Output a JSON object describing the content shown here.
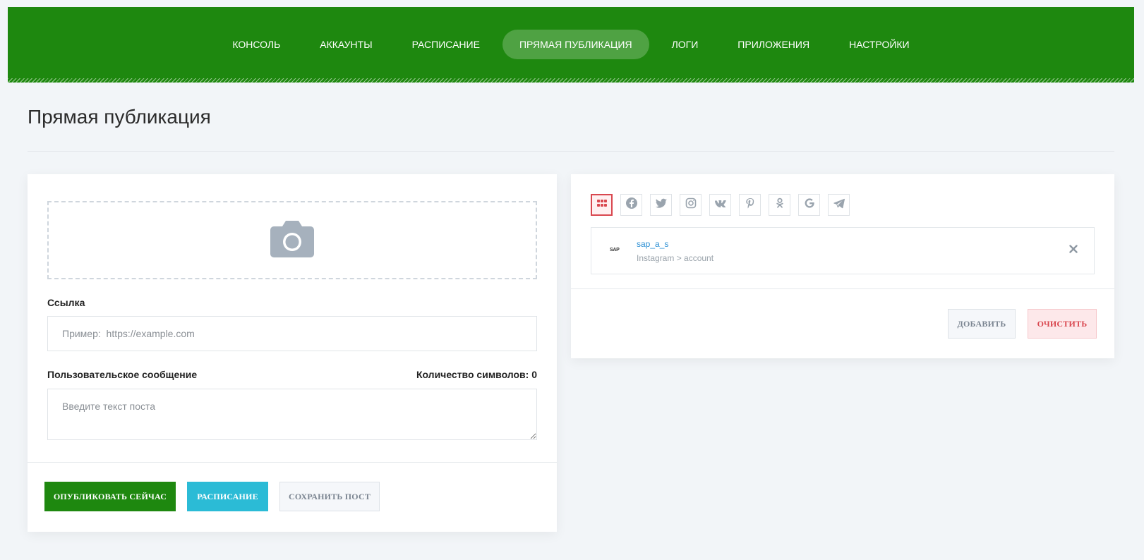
{
  "nav": {
    "items": [
      {
        "label": "КОНСОЛЬ"
      },
      {
        "label": "АККАУНТЫ"
      },
      {
        "label": "РАСПИСАНИЕ"
      },
      {
        "label": "ПРЯМАЯ ПУБЛИКАЦИЯ",
        "active": true
      },
      {
        "label": "ЛОГИ"
      },
      {
        "label": "ПРИЛОЖЕНИЯ"
      },
      {
        "label": "НАСТРОЙКИ"
      }
    ]
  },
  "page": {
    "title": "Прямая публикация"
  },
  "form": {
    "uploader_icon": "camera-icon",
    "link_label": "Ссылка",
    "link_placeholder": "Пример:  https://example.com",
    "link_value": "",
    "message_label": "Пользовательское сообщение",
    "char_count_label": "Количество символов: 0",
    "message_placeholder": "Введите текст поста",
    "message_value": ""
  },
  "actions": {
    "publish_now": "ОПУБЛИКОВАТЬ СЕЙЧАС",
    "schedule": "РАСПИСАНИЕ",
    "save_post": "СОХРАНИТЬ ПОСТ"
  },
  "accounts_panel": {
    "filters": [
      {
        "icon": "apps-grid-icon",
        "active": true
      },
      {
        "icon": "facebook-icon"
      },
      {
        "icon": "twitter-icon"
      },
      {
        "icon": "instagram-icon"
      },
      {
        "icon": "vk-icon"
      },
      {
        "icon": "pinterest-icon"
      },
      {
        "icon": "odnoklassniki-icon"
      },
      {
        "icon": "google-icon"
      },
      {
        "icon": "telegram-icon"
      }
    ],
    "account": {
      "logo_text": "SAP",
      "name": "sap_a_s",
      "type": "Instagram > account"
    },
    "add_label": "ДОБАВИТЬ",
    "clear_label": "ОЧИСТИТЬ"
  },
  "colors": {
    "brand_green": "#1e880f",
    "cyan": "#2bbbd6",
    "danger": "#d9474f",
    "link_blue": "#2b8fd4",
    "page_bg": "#f2f5f8"
  }
}
